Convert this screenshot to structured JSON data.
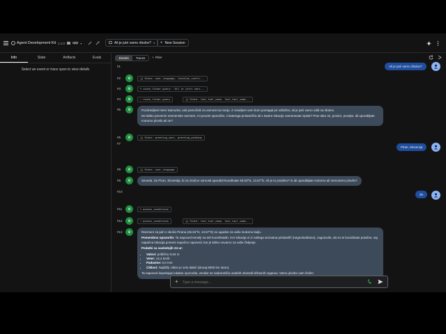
{
  "header": {
    "title": "Agent Development Kit",
    "version": "2.3.0",
    "app_label": "app",
    "session_title": "Ali je jutri varno ribolov?",
    "new_session": "New Session"
  },
  "left": {
    "tabs": [
      "Info",
      "State",
      "Artifacts",
      "Evals"
    ],
    "message": "Select an event or trace span to view details"
  },
  "main": {
    "tabs": [
      "Events",
      "Traces"
    ],
    "filter": "Filter"
  },
  "events": [
    {
      "id": "#1",
      "user": "Ali je jutri varno ribolov?"
    },
    {
      "id": "#2",
      "chip": "State: user_language, location_confir..."
    },
    {
      "id": "#3",
      "chip": "route_fisher_query: 'Ali je jutri varn..."
    },
    {
      "id": "#4",
      "chip": "route_fisher_query",
      "chip2": "State: last_tool_name, last_tool_summ..."
    },
    {
      "id": "#5",
      "text1": "Pozdravljeni! Sem Samudra, vaš pomočnik za varnost na morju. Z veseljem vam bom pomagal pri odločitvi, ali je jutri varno oditi na ribolov.",
      "text2": "Da lahko preverim vremenske razmere, mi prosim sporočite, s katerega pristanišča ali s katere lokacije nameravate izpluti? Prav tako mi, prosim, povejte, ali uporabljate motorno plovilo ali ne?"
    },
    {
      "id": "#6",
      "chip": "State: greeting_sent, greeting_pending"
    },
    {
      "id": "#7",
      "user": "Piran, Slovenija"
    },
    {
      "id": "#8",
      "chip": "State: user_language"
    },
    {
      "id": "#9",
      "text1": "Seveda. Za Piran, Slovenija, bi za izračun varnosti uporabil koordinate 45.53°N, 13.57°E. Ali je to pravilno? In ali uporabljate motorno ali nemotorno plovilo?"
    },
    {
      "id": "#10",
      "user": "da"
    },
    {
      "id": "#11",
      "chip": "assess_conditions"
    },
    {
      "id": "#12",
      "chip": "assess_conditions",
      "chip2": "State: last_tool_name, last_tool_summ..."
    },
    {
      "id": "#13",
      "intro": "Razmere za jutri v okolici Pirana (45.53°N, 13.57°E) so ugodne za vašo motorno ladjo.",
      "warn_label": "Pomembno opozorilo:",
      "warn_text": "Ta napoved temelji na teh koordinatah. Ker lokacija ni iz našega seznama pristanišč (negeokodirano), zagotovite, da so te koordinate pravilne, saj napačna lokacija pomeni napačno napoved, kar je lahko nevarno za vaše življenje.",
      "details_label": "Podatki za naslednjih 24 ur:",
      "details": [
        {
          "k": "Valovi:",
          "v": " približno 0,04 m"
        },
        {
          "k": "Veter:",
          "v": " 14,2 km/h"
        },
        {
          "k": "Padavine:",
          "v": " 0,0 mm"
        },
        {
          "k": "Cikloni:",
          "v": " Najbližji ciklon je zelo daleč (skoraj 8000 km stran)."
        }
      ],
      "outro": "Ta napoved dopolnjuje lokalne opozorila, vendar ne nadomešča uradnih obvestil državnih organov. Varno plovbo vam želim!"
    }
  ],
  "input": {
    "placeholder": "Type a message..."
  },
  "colors": {
    "accent": "#1f4e9e",
    "bot_bubble": "#3c4a5a",
    "agent_avatar": "#1e8e3e",
    "background": "#131314"
  }
}
